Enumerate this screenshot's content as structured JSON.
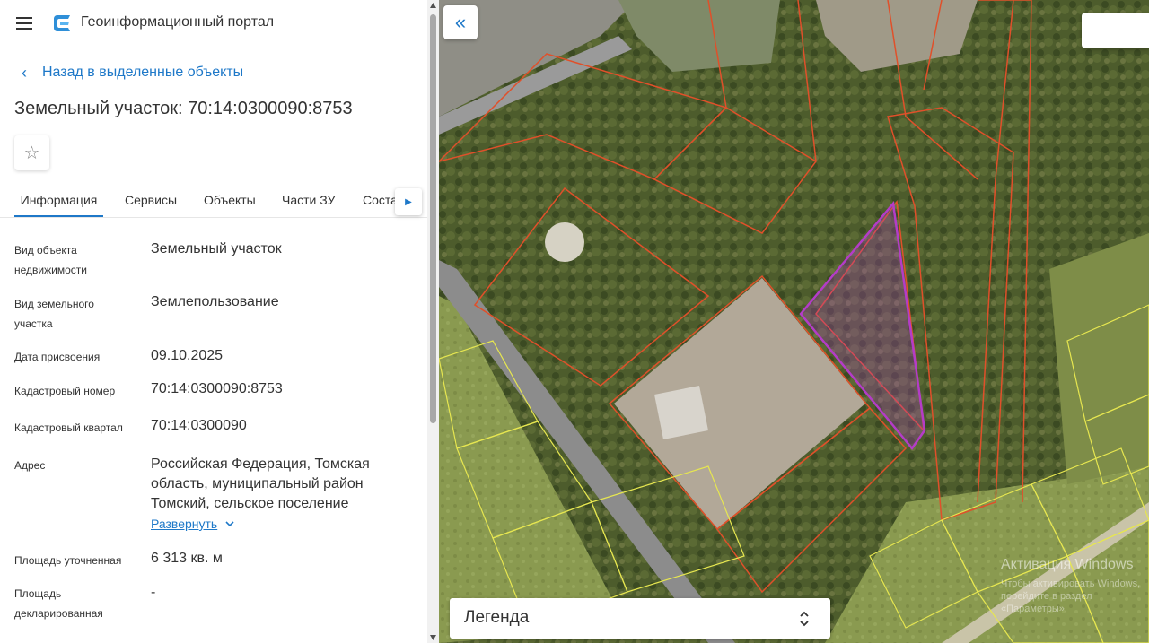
{
  "app": {
    "title": "Геоинформационный портал"
  },
  "nav": {
    "back_label": "Назад в выделенные объекты"
  },
  "object": {
    "title": "Земельный участок: 70:14:0300090:8753"
  },
  "tabs": [
    {
      "label": "Информация",
      "active": true
    },
    {
      "label": "Сервисы",
      "active": false
    },
    {
      "label": "Объекты",
      "active": false
    },
    {
      "label": "Части ЗУ",
      "active": false
    },
    {
      "label": "Соста",
      "active": false
    }
  ],
  "attributes": [
    {
      "label": "Вид объекта недвижимости",
      "value": "Земельный участок"
    },
    {
      "label": "Вид земельного участка",
      "value": "Землепользование"
    },
    {
      "label": "Дата присвоения",
      "value": "09.10.2025"
    },
    {
      "label": "Кадастровый номер",
      "value": "70:14:0300090:8753"
    },
    {
      "label": "Кадастровый квартал",
      "value": "70:14:0300090"
    },
    {
      "label": "Адрес",
      "value": "Российская Федерация, Томская область, муниципальный район Томский, сельское поселение"
    },
    {
      "label": "Площадь уточненная",
      "value": "6 313 кв. м"
    },
    {
      "label": "Площадь декларированная",
      "value": "-"
    }
  ],
  "address_expand_label": "Развернуть",
  "map": {
    "legend_label": "Легенда",
    "watermark_title": "Активация Windows",
    "watermark_sub": "Чтобы активировать Windows, перейдите в раздел «Параметры»."
  },
  "colors": {
    "accent": "#1e78c8",
    "parcel_border": "#e0502a",
    "selected_parcel": "#b43cc8",
    "zone_border": "#e6e650"
  },
  "icons": {
    "menu": "hamburger-icon",
    "logo": "portal-logo-icon",
    "back": "chevron-left-icon",
    "favorite": "star-outline-icon",
    "tabs_next": "caret-right-icon",
    "expand": "chevron-down-icon",
    "collapse_panel": "double-chevron-left-icon",
    "legend_toggle": "chevron-up-down-icon"
  }
}
